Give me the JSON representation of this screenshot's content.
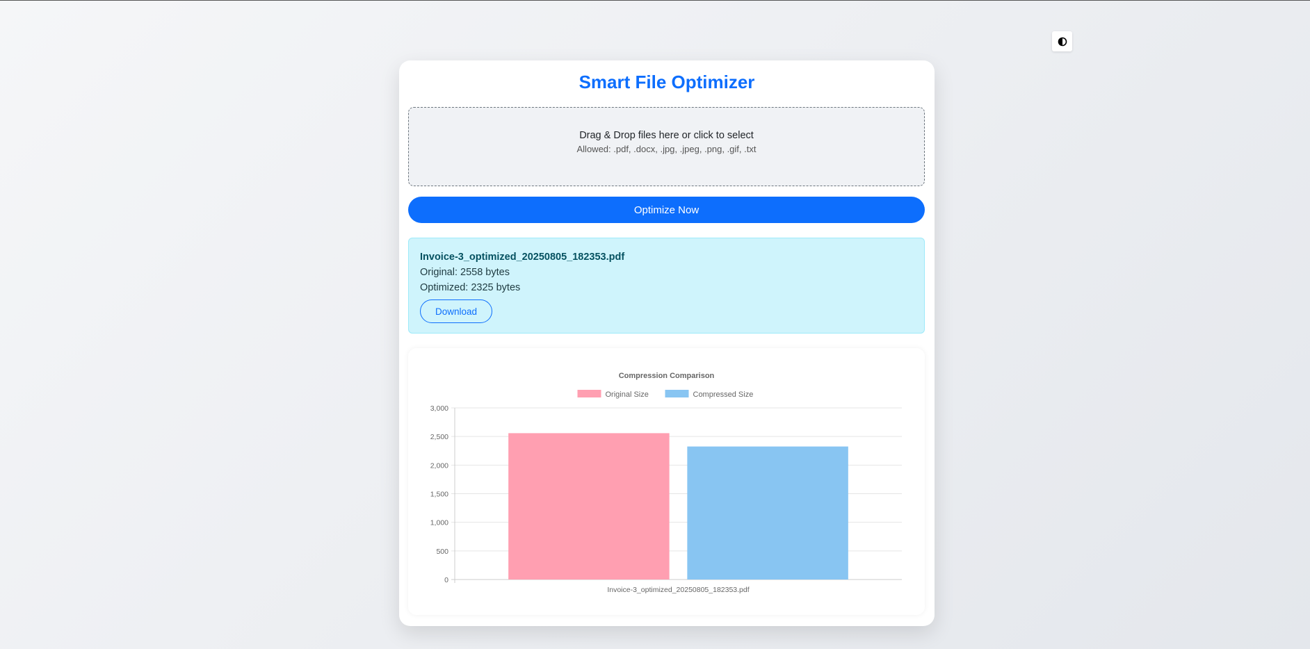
{
  "theme_toggle": {
    "icon": "contrast-icon"
  },
  "header": {
    "title": "Smart File Optimizer"
  },
  "dropzone": {
    "text": "Drag & Drop files here or click to select",
    "allowed": "Allowed: .pdf, .docx, .jpg, .jpeg, .png, .gif, .txt"
  },
  "actions": {
    "optimize_label": "Optimize Now"
  },
  "result": {
    "filename": "Invoice-3_optimized_20250805_182353.pdf",
    "original": "Original: 2558 bytes",
    "optimized": "Optimized: 2325 bytes",
    "download_label": "Download"
  },
  "colors": {
    "accent": "#0d6efd",
    "original_bar": "#ff9fb1",
    "compressed_bar": "#88c5f2"
  },
  "chart_data": {
    "type": "bar",
    "title": "Compression Comparison",
    "categories": [
      "Invoice-3_optimized_20250805_182353.pdf"
    ],
    "series": [
      {
        "name": "Original Size",
        "values": [
          2558
        ],
        "color": "#ff9fb1"
      },
      {
        "name": "Compressed Size",
        "values": [
          2325
        ],
        "color": "#88c5f2"
      }
    ],
    "ylim": [
      0,
      3000
    ],
    "yticks": [
      "0",
      "500",
      "1,000",
      "1,500",
      "2,000",
      "2,500",
      "3,000"
    ],
    "ytick_values": [
      0,
      500,
      1000,
      1500,
      2000,
      2500,
      3000
    ],
    "legend": "top",
    "grid": true
  }
}
